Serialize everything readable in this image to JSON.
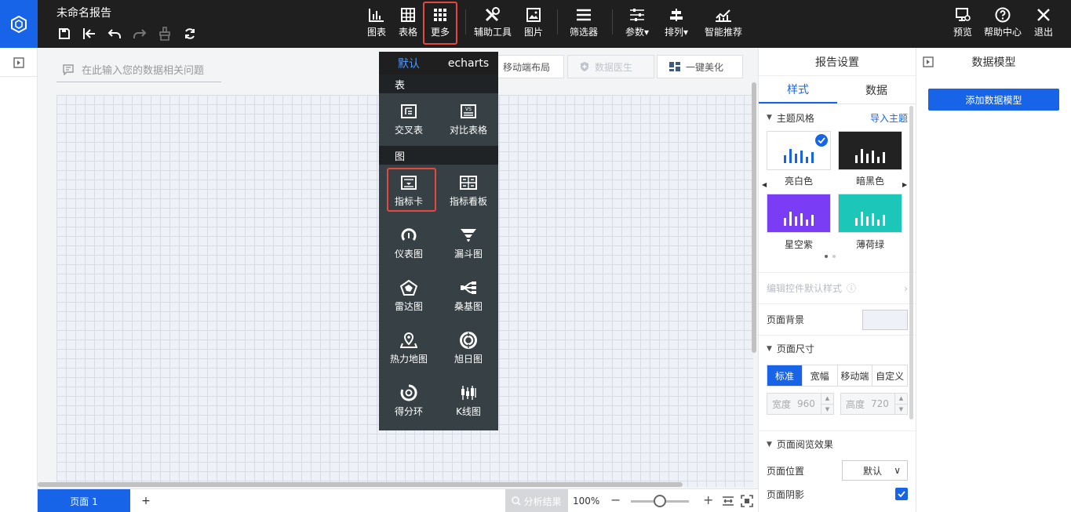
{
  "app": {
    "doc_title": "未命名报告"
  },
  "toolbar": {
    "chart": "图表",
    "table": "表格",
    "more": "更多",
    "assist": "辅助工具",
    "image": "图片",
    "filter": "筛选器",
    "params": "参数▾",
    "arrange": "排列▾",
    "smart": "智能推荐",
    "preview": "预览",
    "help": "帮助中心",
    "exit": "退出"
  },
  "canvas": {
    "ask_placeholder": "在此输入您的数据相关问题",
    "mobile_layout": "移动端布局",
    "data_doctor": "数据医生",
    "beautify": "一键美化"
  },
  "dropdown": {
    "tabs": [
      "默认",
      "echarts"
    ],
    "section_table": "表",
    "section_chart": "图",
    "table_items": [
      "交叉表",
      "对比表格"
    ],
    "chart_items": [
      "指标卡",
      "指标看板",
      "仪表图",
      "漏斗图",
      "雷达图",
      "桑基图",
      "热力地图",
      "旭日图",
      "得分环",
      "K线图"
    ]
  },
  "settings": {
    "title": "报告设置",
    "tabs": [
      "样式",
      "数据"
    ],
    "theme_section": "主题风格",
    "import_theme": "导入主题",
    "themes": [
      {
        "name": "亮白色",
        "bg": "#ffffff",
        "bar": "#1764e8"
      },
      {
        "name": "暗黑色",
        "bg": "#222222",
        "bar": "#ffffff"
      },
      {
        "name": "星空紫",
        "bg": "#7b3cf5",
        "bar": "#ffffff"
      },
      {
        "name": "薄荷绿",
        "bg": "#1cc6b8",
        "bar": "#ffffff"
      }
    ],
    "edit_default_style": "编辑控件默认样式",
    "page_bg": "页面背景",
    "page_size_section": "页面尺寸",
    "sizes": [
      "标准",
      "宽幅",
      "移动端",
      "自定义"
    ],
    "width_label": "宽度",
    "width_value": "960",
    "height_label": "高度",
    "height_value": "720",
    "view_effect_section": "页面阅览效果",
    "page_position": "页面位置",
    "page_position_value": "默认",
    "page_shadow": "页面阴影"
  },
  "model": {
    "title": "数据模型",
    "add_button": "添加数据模型"
  },
  "bottom": {
    "page_tab": "页面 1",
    "add": "+",
    "analysis": "分析结果",
    "zoom": "100%",
    "zoom_fraction": 0.5
  },
  "colors": {
    "accent": "#1764e8",
    "topbar": "#1f1f1f",
    "highlight": "#e5483f",
    "menu_bg": "#374044"
  }
}
